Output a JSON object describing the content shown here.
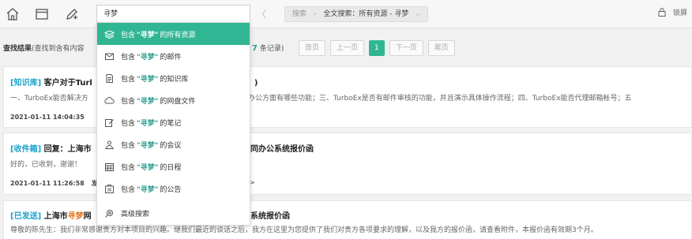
{
  "toolbar": {
    "search_value": "寻梦",
    "back_arrow": "〈",
    "breadcrumb": {
      "root": "搜索",
      "separator": "›",
      "current": "全文搜索：所有资源 - 寻梦",
      "caret": "⌵"
    },
    "lock_label": "锁屏",
    "icons": [
      "home-icon",
      "window-icon",
      "compose-icon",
      "lock-icon"
    ]
  },
  "results_header": {
    "title": "查找结果",
    "hint": "(查找到含有内容",
    "count_num": "7",
    "count_suffix": "条记录)"
  },
  "pager": {
    "first": "首页",
    "prev": "上一页",
    "current": "1",
    "next": "下一页",
    "last": "尾页"
  },
  "results": [
    {
      "tag": "[知识库]",
      "title_pre": "客户对于Turl",
      "title_post": ")",
      "snippet_left": "一、TurboEx能否解决方",
      "snippet_right": "办公方面有哪些功能；三、TurboEx是否有邮件审核的功能，并且演示具体操作流程；四、TurboEx能否代理邮箱帐号；五",
      "date": "2021-01-11 14:04:35"
    },
    {
      "tag": "[收件箱]",
      "title_pre": "回复：上海市",
      "title_post": "同办公系统报价函",
      "snippet_left": "好的，已收到，谢谢！",
      "date": "2021-01-11 11:26:58",
      "meta_extra": "发件",
      "meta_right": ">"
    },
    {
      "tag": "[已发送]",
      "title_pre": "上海市",
      "title_hl": "寻梦",
      "title_mid": "网",
      "title_post": "系统报价函",
      "snippet": "尊敬的陈先生：我们非常感谢贵方对本项目的兴趣。继我们最近的谈话之后，我方在这里为您提供了我们对贵方各项要求的理解，以及我方的报价函，请查看附件，本报价函有效期3个月。"
    }
  ],
  "dropdown": {
    "keyword": "\"寻梦\"",
    "items": [
      {
        "prefix": "包含",
        "suffix": "的所有资源",
        "icon": "layers-icon",
        "active": true
      },
      {
        "prefix": "包含",
        "suffix": "的邮件",
        "icon": "mail-icon",
        "active": false
      },
      {
        "prefix": "包含",
        "suffix": "的知识库",
        "icon": "document-icon",
        "active": false
      },
      {
        "prefix": "包含",
        "suffix": "的网盘文件",
        "icon": "cloud-icon",
        "active": false
      },
      {
        "prefix": "包含",
        "suffix": "的笔记",
        "icon": "note-icon",
        "active": false
      },
      {
        "prefix": "包含",
        "suffix": "的会议",
        "icon": "meeting-icon",
        "active": false
      },
      {
        "prefix": "包含",
        "suffix": "的日程",
        "icon": "calendar-icon",
        "active": false
      },
      {
        "prefix": "包含",
        "suffix": "的公告",
        "icon": "notice-icon",
        "active": false
      }
    ],
    "advanced": {
      "label": "高级搜索",
      "icon": "advanced-search-icon"
    }
  },
  "colors": {
    "accent": "#31b693",
    "tag_blue": "#1aa0c8",
    "highlight_orange": "#e8741c"
  }
}
